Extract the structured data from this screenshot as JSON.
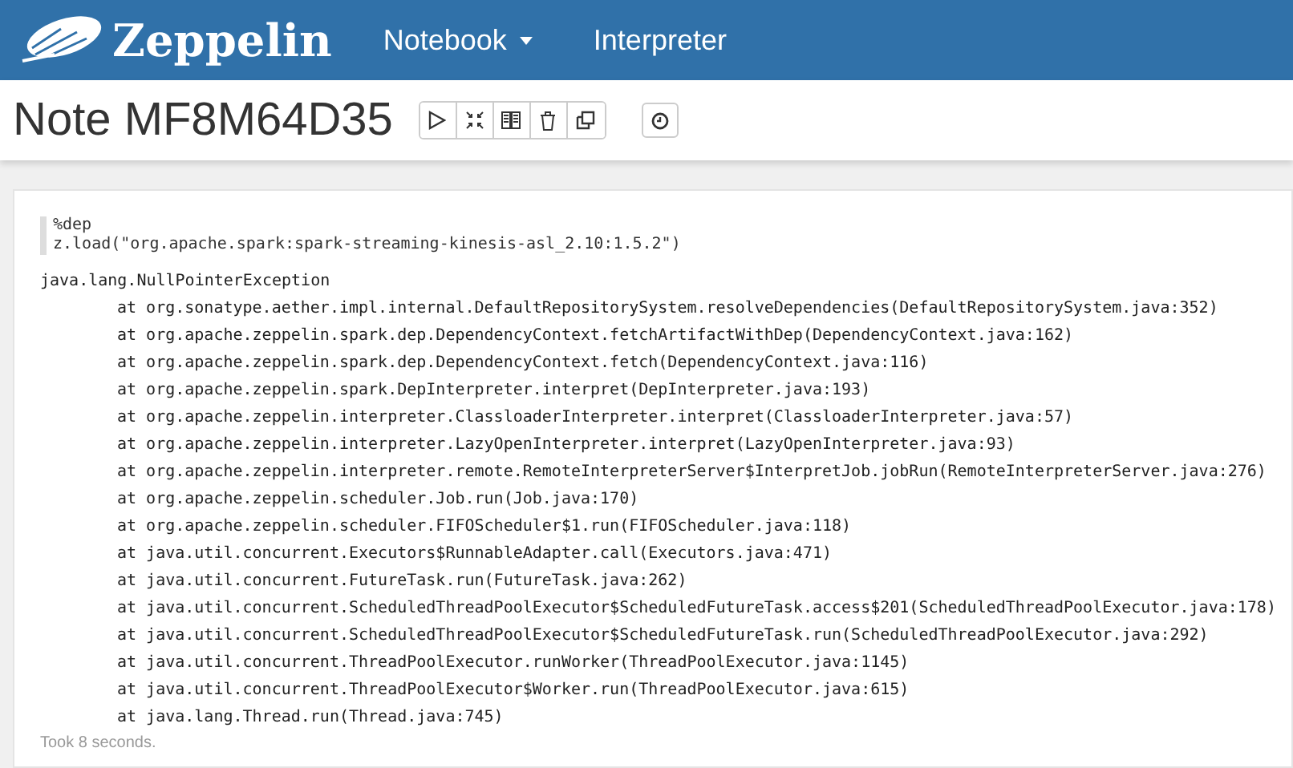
{
  "navbar": {
    "brand": "Zeppelin",
    "menu": [
      {
        "label": "Notebook",
        "kind": "dropdown"
      },
      {
        "label": "Interpreter",
        "kind": "link"
      }
    ]
  },
  "note": {
    "title": "Note MF8M64D35",
    "actions": [
      {
        "kind": "run"
      },
      {
        "kind": "collapse"
      },
      {
        "kind": "book"
      },
      {
        "kind": "trash"
      },
      {
        "kind": "clone"
      }
    ],
    "schedule": {
      "kind": "clock"
    }
  },
  "paragraph": {
    "code": [
      "%dep",
      "z.load(\"org.apache.spark:spark-streaming-kinesis-asl_2.10:1.5.2\")"
    ],
    "output": [
      {
        "kind": "exception",
        "text": "java.lang.NullPointerException"
      },
      {
        "kind": "frame",
        "text": "at org.sonatype.aether.impl.internal.DefaultRepositorySystem.resolveDependencies(DefaultRepositorySystem.java:352)"
      },
      {
        "kind": "frame",
        "text": "at org.apache.zeppelin.spark.dep.DependencyContext.fetchArtifactWithDep(DependencyContext.java:162)"
      },
      {
        "kind": "frame",
        "text": "at org.apache.zeppelin.spark.dep.DependencyContext.fetch(DependencyContext.java:116)"
      },
      {
        "kind": "frame",
        "text": "at org.apache.zeppelin.spark.DepInterpreter.interpret(DepInterpreter.java:193)"
      },
      {
        "kind": "frame",
        "text": "at org.apache.zeppelin.interpreter.ClassloaderInterpreter.interpret(ClassloaderInterpreter.java:57)"
      },
      {
        "kind": "frame",
        "text": "at org.apache.zeppelin.interpreter.LazyOpenInterpreter.interpret(LazyOpenInterpreter.java:93)"
      },
      {
        "kind": "frame",
        "text": "at org.apache.zeppelin.interpreter.remote.RemoteInterpreterServer$InterpretJob.jobRun(RemoteInterpreterServer.java:276)"
      },
      {
        "kind": "frame",
        "text": "at org.apache.zeppelin.scheduler.Job.run(Job.java:170)"
      },
      {
        "kind": "frame",
        "text": "at org.apache.zeppelin.scheduler.FIFOScheduler$1.run(FIFOScheduler.java:118)"
      },
      {
        "kind": "frame",
        "text": "at java.util.concurrent.Executors$RunnableAdapter.call(Executors.java:471)"
      },
      {
        "kind": "frame",
        "text": "at java.util.concurrent.FutureTask.run(FutureTask.java:262)"
      },
      {
        "kind": "frame",
        "text": "at java.util.concurrent.ScheduledThreadPoolExecutor$ScheduledFutureTask.access$201(ScheduledThreadPoolExecutor.java:178)"
      },
      {
        "kind": "frame",
        "text": "at java.util.concurrent.ScheduledThreadPoolExecutor$ScheduledFutureTask.run(ScheduledThreadPoolExecutor.java:292)"
      },
      {
        "kind": "frame",
        "text": "at java.util.concurrent.ThreadPoolExecutor.runWorker(ThreadPoolExecutor.java:1145)"
      },
      {
        "kind": "frame",
        "text": "at java.util.concurrent.ThreadPoolExecutor$Worker.run(ThreadPoolExecutor.java:615)"
      },
      {
        "kind": "frame",
        "text": "at java.lang.Thread.run(Thread.java:745)"
      }
    ],
    "status": "Took 8 seconds."
  }
}
